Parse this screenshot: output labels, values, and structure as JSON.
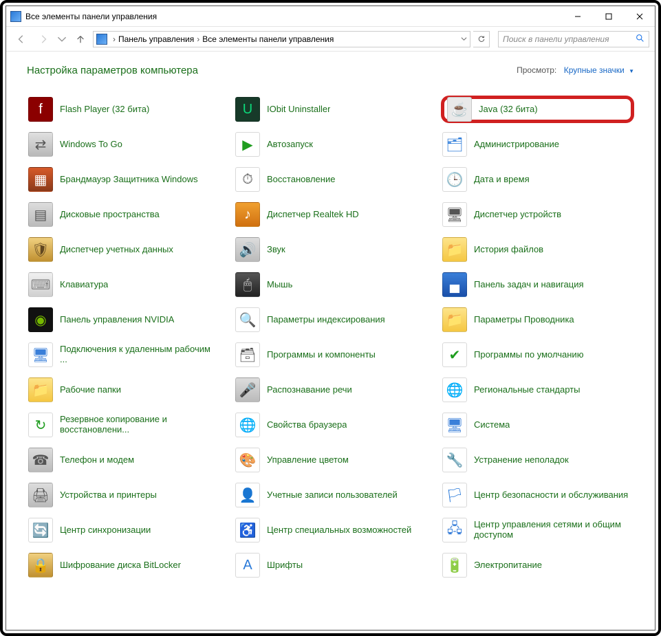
{
  "window_title": "Все элементы панели управления",
  "breadcrumbs": [
    "Панель управления",
    "Все элементы панели управления"
  ],
  "search_placeholder": "Поиск в панели управления",
  "heading": "Настройка параметров компьютера",
  "view_label": "Просмотр:",
  "view_value": "Крупные значки",
  "items": [
    {
      "label": "Flash Player (32 бита)",
      "icon": "flash",
      "bg": "#8b0000",
      "fg": "#fff",
      "glyph": "f"
    },
    {
      "label": "IObit Uninstaller",
      "icon": "iobit",
      "bg": "#173a29",
      "fg": "#0cd97a",
      "glyph": "U"
    },
    {
      "label": "Java (32 бита)",
      "icon": "java",
      "bg": "#e9e9e9",
      "fg": "#d9534f",
      "glyph": "☕",
      "highlight": true
    },
    {
      "label": "Windows To Go",
      "icon": "wtg",
      "bg": "linear-gradient(#e0e0e0,#b8b8b8)",
      "fg": "#555",
      "glyph": "⇄"
    },
    {
      "label": "Автозапуск",
      "icon": "autoplay",
      "bg": "#fff",
      "fg": "#1f9d1f",
      "glyph": "▶"
    },
    {
      "label": "Администрирование",
      "icon": "admin",
      "bg": "#fff",
      "fg": "#2a7ad9",
      "glyph": "🗂"
    },
    {
      "label": "Брандмауэр Защитника Windows",
      "icon": "firewall",
      "bg": "linear-gradient(#d65a2a,#8b3a1a)",
      "fg": "#fff",
      "glyph": "▦"
    },
    {
      "label": "Восстановление",
      "icon": "recovery",
      "bg": "#fff",
      "fg": "#555",
      "glyph": "⏱"
    },
    {
      "label": "Дата и время",
      "icon": "datetime",
      "bg": "#fff",
      "fg": "#555",
      "glyph": "🕒"
    },
    {
      "label": "Дисковые пространства",
      "icon": "storagespaces",
      "bg": "linear-gradient(#ddd,#bbb)",
      "fg": "#555",
      "glyph": "▤"
    },
    {
      "label": "Диспетчер Realtek HD",
      "icon": "realtek",
      "bg": "linear-gradient(#f0a030,#d07010)",
      "fg": "#fff",
      "glyph": "♪"
    },
    {
      "label": "Диспетчер устройств",
      "icon": "devicemgr",
      "bg": "#fff",
      "fg": "#555",
      "glyph": "🖥"
    },
    {
      "label": "Диспетчер учетных данных",
      "icon": "credentials",
      "bg": "linear-gradient(#f0d080,#c09030)",
      "fg": "#614720",
      "glyph": "🛡"
    },
    {
      "label": "Звук",
      "icon": "sound",
      "bg": "linear-gradient(#ddd,#bbb)",
      "fg": "#555",
      "glyph": "🔊"
    },
    {
      "label": "История файлов",
      "icon": "filehistory",
      "bg": "linear-gradient(#fde48a,#f5c742)",
      "fg": "#8a6d00",
      "glyph": "📁"
    },
    {
      "label": "Клавиатура",
      "icon": "keyboard",
      "bg": "linear-gradient(#f0f0f0,#d0d0d0)",
      "fg": "#888",
      "glyph": "⌨"
    },
    {
      "label": "Мышь",
      "icon": "mouse",
      "bg": "linear-gradient(#555,#222)",
      "fg": "#ddd",
      "glyph": "🖱"
    },
    {
      "label": "Панель задач и навигация",
      "icon": "taskbar",
      "bg": "linear-gradient(#3a7fd9,#1a4fa9)",
      "fg": "#fff",
      "glyph": "▄"
    },
    {
      "label": "Панель управления NVIDIA",
      "icon": "nvidia",
      "bg": "#111",
      "fg": "#76b900",
      "glyph": "◉"
    },
    {
      "label": "Параметры индексирования",
      "icon": "indexing",
      "bg": "#fff",
      "fg": "#3a7fd9",
      "glyph": "🔍"
    },
    {
      "label": "Параметры Проводника",
      "icon": "folderopts",
      "bg": "linear-gradient(#fde48a,#f5c742)",
      "fg": "#8a6d00",
      "glyph": "📁"
    },
    {
      "label": "Подключения к удаленным рабочим ...",
      "icon": "remoteapp",
      "bg": "#fff",
      "fg": "#3a7fd9",
      "glyph": "🖥"
    },
    {
      "label": "Программы и компоненты",
      "icon": "programs",
      "bg": "#fff",
      "fg": "#555",
      "glyph": "🗃"
    },
    {
      "label": "Программы по умолчанию",
      "icon": "defaultprogs",
      "bg": "#fff",
      "fg": "#1f9d1f",
      "glyph": "✔"
    },
    {
      "label": "Рабочие папки",
      "icon": "workfolders",
      "bg": "linear-gradient(#fde48a,#f5c742)",
      "fg": "#8a6d00",
      "glyph": "📁"
    },
    {
      "label": "Распознавание речи",
      "icon": "speech",
      "bg": "linear-gradient(#ddd,#bbb)",
      "fg": "#555",
      "glyph": "🎤"
    },
    {
      "label": "Региональные стандарты",
      "icon": "region",
      "bg": "#fff",
      "fg": "#3a7fd9",
      "glyph": "🌐"
    },
    {
      "label": "Резервное копирование и восстановлени...",
      "icon": "backup",
      "bg": "#fff",
      "fg": "#1f9d1f",
      "glyph": "↻"
    },
    {
      "label": "Свойства браузера",
      "icon": "inetopts",
      "bg": "#fff",
      "fg": "#3a7fd9",
      "glyph": "🌐"
    },
    {
      "label": "Система",
      "icon": "system",
      "bg": "#fff",
      "fg": "#3a7fd9",
      "glyph": "🖥"
    },
    {
      "label": "Телефон и модем",
      "icon": "phonemodem",
      "bg": "linear-gradient(#ddd,#bbb)",
      "fg": "#555",
      "glyph": "☎"
    },
    {
      "label": "Управление цветом",
      "icon": "colormgmt",
      "bg": "#fff",
      "fg": "#555",
      "glyph": "🎨"
    },
    {
      "label": "Устранение неполадок",
      "icon": "troubleshoot",
      "bg": "#fff",
      "fg": "#3a7fd9",
      "glyph": "🔧"
    },
    {
      "label": "Устройства и принтеры",
      "icon": "devicesprinters",
      "bg": "linear-gradient(#ddd,#bbb)",
      "fg": "#555",
      "glyph": "🖨"
    },
    {
      "label": "Учетные записи пользователей",
      "icon": "useraccounts",
      "bg": "#fff",
      "fg": "#2f8f3f",
      "glyph": "👤"
    },
    {
      "label": "Центр безопасности и обслуживания",
      "icon": "securitycenter",
      "bg": "#fff",
      "fg": "#2a7ad9",
      "glyph": "🏳"
    },
    {
      "label": "Центр синхронизации",
      "icon": "synccenter",
      "bg": "#fff",
      "fg": "#1f9d1f",
      "glyph": "🔄"
    },
    {
      "label": "Центр специальных возможностей",
      "icon": "easeofaccess",
      "bg": "#fff",
      "fg": "#3a7fd9",
      "glyph": "♿"
    },
    {
      "label": "Центр управления сетями и общим доступом",
      "icon": "networkcenter",
      "bg": "#fff",
      "fg": "#3a7fd9",
      "glyph": "🖧"
    },
    {
      "label": "Шифрование диска BitLocker",
      "icon": "bitlocker",
      "bg": "linear-gradient(#f0d080,#c09030)",
      "fg": "#614720",
      "glyph": "🔒"
    },
    {
      "label": "Шрифты",
      "icon": "fonts",
      "bg": "#fff",
      "fg": "#2a7ad9",
      "glyph": "A"
    },
    {
      "label": "Электропитание",
      "icon": "power",
      "bg": "#fff",
      "fg": "#2fa02f",
      "glyph": "🔋"
    }
  ]
}
